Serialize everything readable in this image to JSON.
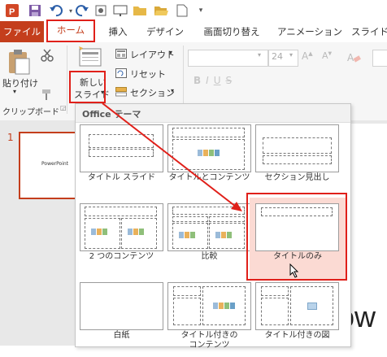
{
  "tabs": {
    "file": "ファイル",
    "home": "ホーム",
    "insert": "挿入",
    "design": "デザイン",
    "transitions": "画面切り替え",
    "animations": "アニメーション",
    "slideshow": "スライド"
  },
  "ribbon": {
    "paste": "貼り付け",
    "clipboard_group": "クリップボード",
    "new_slide_line1": "新しい",
    "new_slide_line2": "スライド",
    "new_slide_caret": "▾",
    "layout": "レイアウト",
    "reset": "リセット",
    "section": "セクション",
    "font_size": "24"
  },
  "slide_panel": {
    "slide_number": "1",
    "thumb_text": "PowerPoint"
  },
  "main_slide": {
    "visible_text": "ow"
  },
  "gallery": {
    "header": "Office テーマ",
    "layouts": [
      "タイトル スライド",
      "タイトルとコンテンツ",
      "セクション見出し",
      "2 つのコンテンツ",
      "比較",
      "タイトルのみ",
      "白紙",
      "タイトル付きの\nコンテンツ",
      "タイトル付きの図"
    ],
    "selected": "タイトルのみ"
  },
  "colors": {
    "accent": "#c43e1c",
    "annotation_red": "#e0201a",
    "selected_layout_bg": "#fbdad3"
  }
}
